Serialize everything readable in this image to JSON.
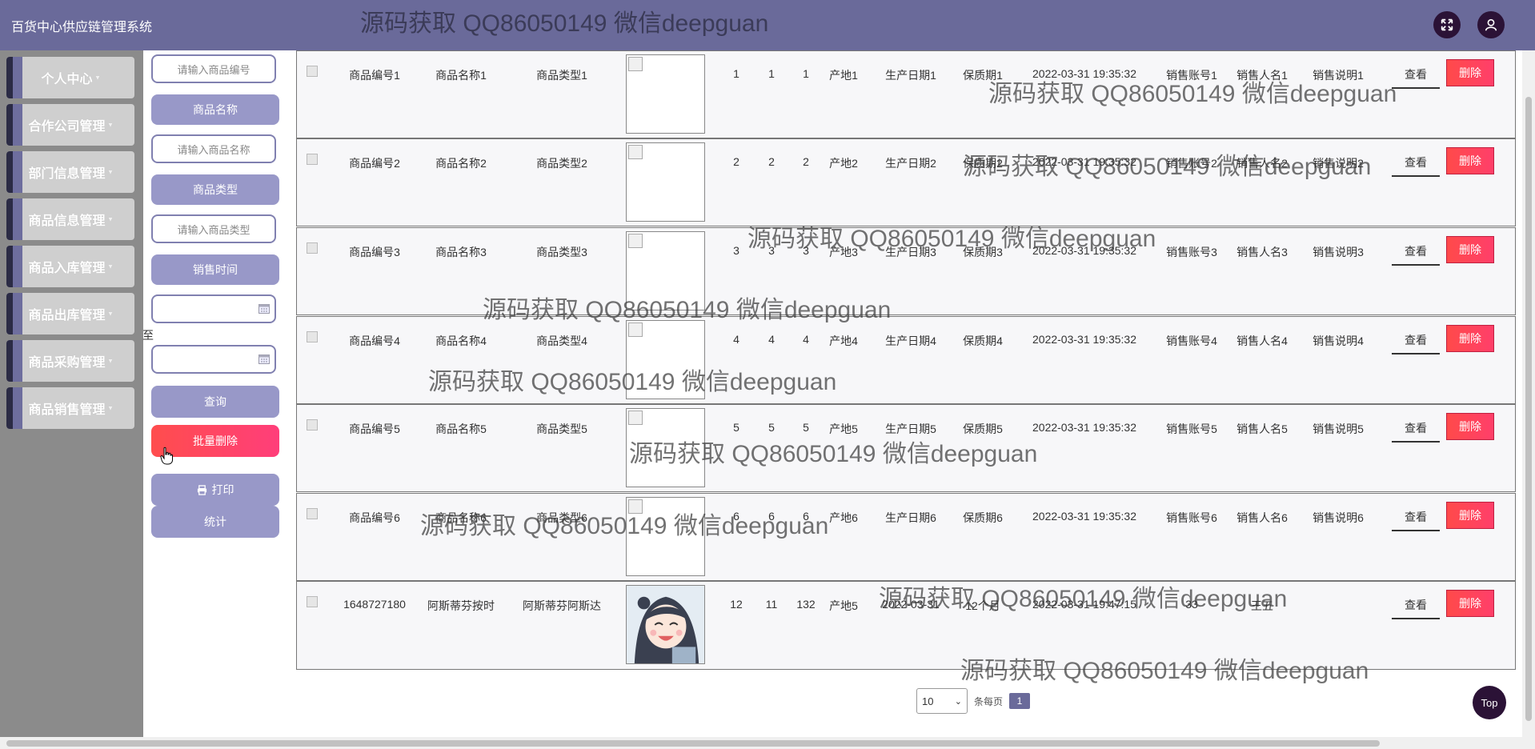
{
  "app": {
    "title": "百货中心供应链管理系统",
    "watermark": "源码获取 QQ86050149 微信deepguan"
  },
  "header": {
    "fullscreen_icon": "expand-icon",
    "user_icon": "user-icon"
  },
  "sidebar": {
    "items": [
      {
        "label": "个人中心"
      },
      {
        "label": "合作公司管理"
      },
      {
        "label": "部门信息管理"
      },
      {
        "label": "商品信息管理"
      },
      {
        "label": "商品入库管理"
      },
      {
        "label": "商品出库管理"
      },
      {
        "label": "商品采购管理"
      },
      {
        "label": "商品销售管理"
      }
    ],
    "caret": "▾"
  },
  "search": {
    "code_placeholder": "请输入商品编号",
    "name_label": "商品名称",
    "name_placeholder": "请输入商品名称",
    "type_label": "商品类型",
    "type_placeholder": "请输入商品类型",
    "time_label": "销售时间",
    "to_label": "至",
    "query_button": "查询",
    "batch_delete_button": "批量删除",
    "print_button": "打印",
    "stats_button": "统计"
  },
  "table": {
    "view_label": "查看",
    "delete_label": "删除",
    "rows": [
      {
        "code": "商品编号1",
        "name": "商品名称1",
        "type": "商品类型1",
        "n1": "1",
        "n2": "1",
        "n3": "1",
        "origin": "产地1",
        "prod_date": "生产日期1",
        "shelf": "保质期1",
        "time": "2022-03-31 19:35:32",
        "account": "销售账号1",
        "seller": "销售人名1",
        "note": "销售说明1",
        "image": "broken"
      },
      {
        "code": "商品编号2",
        "name": "商品名称2",
        "type": "商品类型2",
        "n1": "2",
        "n2": "2",
        "n3": "2",
        "origin": "产地2",
        "prod_date": "生产日期2",
        "shelf": "保质期2",
        "time": "2022-03-31 19:35:32",
        "account": "销售账号2",
        "seller": "销售人名2",
        "note": "销售说明2",
        "image": "broken"
      },
      {
        "code": "商品编号3",
        "name": "商品名称3",
        "type": "商品类型3",
        "n1": "3",
        "n2": "3",
        "n3": "3",
        "origin": "产地3",
        "prod_date": "生产日期3",
        "shelf": "保质期3",
        "time": "2022-03-31 19:35:32",
        "account": "销售账号3",
        "seller": "销售人名3",
        "note": "销售说明3",
        "image": "broken"
      },
      {
        "code": "商品编号4",
        "name": "商品名称4",
        "type": "商品类型4",
        "n1": "4",
        "n2": "4",
        "n3": "4",
        "origin": "产地4",
        "prod_date": "生产日期4",
        "shelf": "保质期4",
        "time": "2022-03-31 19:35:32",
        "account": "销售账号4",
        "seller": "销售人名4",
        "note": "销售说明4",
        "image": "broken"
      },
      {
        "code": "商品编号5",
        "name": "商品名称5",
        "type": "商品类型5",
        "n1": "5",
        "n2": "5",
        "n3": "5",
        "origin": "产地5",
        "prod_date": "生产日期5",
        "shelf": "保质期5",
        "time": "2022-03-31 19:35:32",
        "account": "销售账号5",
        "seller": "销售人名5",
        "note": "销售说明5",
        "image": "broken"
      },
      {
        "code": "商品编号6",
        "name": "商品名称6",
        "type": "商品类型6",
        "n1": "6",
        "n2": "6",
        "n3": "6",
        "origin": "产地6",
        "prod_date": "生产日期6",
        "shelf": "保质期6",
        "time": "2022-03-31 19:35:32",
        "account": "销售账号6",
        "seller": "销售人名6",
        "note": "销售说明6",
        "image": "broken"
      },
      {
        "code": "1648727180",
        "name": "阿斯蒂芬按时",
        "type": "阿斯蒂芬阿斯达",
        "n1": "12",
        "n2": "11",
        "n3": "132",
        "origin": "产地5",
        "prod_date": "2022-03-31",
        "shelf": "12个月",
        "time": "2022-03-31 19:47:15",
        "account": "33",
        "seller": "王五",
        "note": "",
        "image": "anime-avatar"
      }
    ]
  },
  "pagination": {
    "page_size": "10",
    "per_page_label": "条每页",
    "current_page": "1"
  },
  "top_button": "Top"
}
